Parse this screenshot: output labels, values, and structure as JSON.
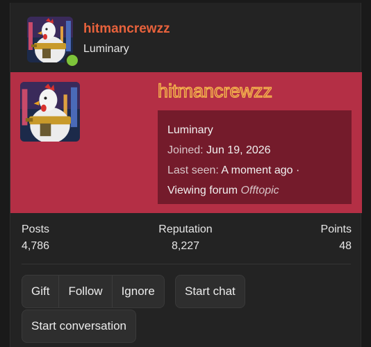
{
  "header": {
    "username": "hitmancrewzz",
    "user_title": "Luminary",
    "online_status": "online"
  },
  "banner": {
    "username": "hitmancrewzz",
    "title": "Luminary",
    "joined_label": "Joined:",
    "joined_value": "Jun 19, 2026",
    "last_seen_label": "Last seen:",
    "last_seen_value": "A moment ago ·",
    "activity_prefix": "Viewing forum",
    "activity_forum": "Offtopic"
  },
  "stats": {
    "posts_label": "Posts",
    "posts_value": "4,786",
    "reputation_label": "Reputation",
    "reputation_value": "8,227",
    "points_label": "Points",
    "points_value": "48"
  },
  "actions": {
    "gift": "Gift",
    "follow": "Follow",
    "ignore": "Ignore",
    "start_chat": "Start chat",
    "start_conversation": "Start conversation"
  },
  "colors": {
    "accent_username": "#e8623c",
    "banner_bg": "#b42f45",
    "info_box_bg": "#741b2b",
    "online_dot": "#7ec43a"
  }
}
